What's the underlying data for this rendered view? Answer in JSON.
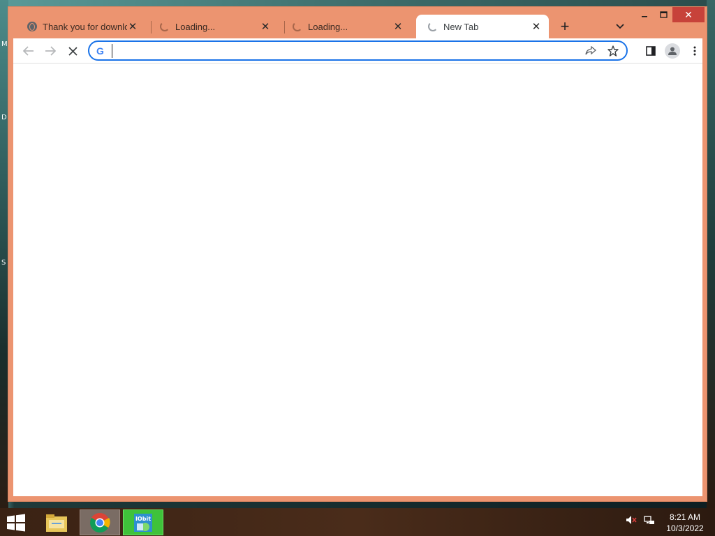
{
  "desktop": {
    "side_letters": [
      "M",
      "D",
      "S"
    ]
  },
  "tabs": [
    {
      "title": "Thank you for downloading",
      "icon": "globe-icon",
      "active": false
    },
    {
      "title": "Loading...",
      "icon": "loading-spinner-icon",
      "active": false
    },
    {
      "title": "Loading...",
      "icon": "loading-spinner-icon",
      "active": false
    },
    {
      "title": "New Tab",
      "icon": "loading-spinner-icon",
      "active": true
    }
  ],
  "toolbar": {
    "omnibox_value": "",
    "omnibox_icon": "google-icon"
  },
  "taskbar": {
    "time": "8:21 AM",
    "date": "10/3/2022",
    "apps": [
      "file-explorer-icon",
      "chrome-icon",
      "iobit-icon"
    ]
  },
  "colors": {
    "frame": "#ec9470",
    "accent": "#1a73e8",
    "close_button": "#c7423a"
  }
}
